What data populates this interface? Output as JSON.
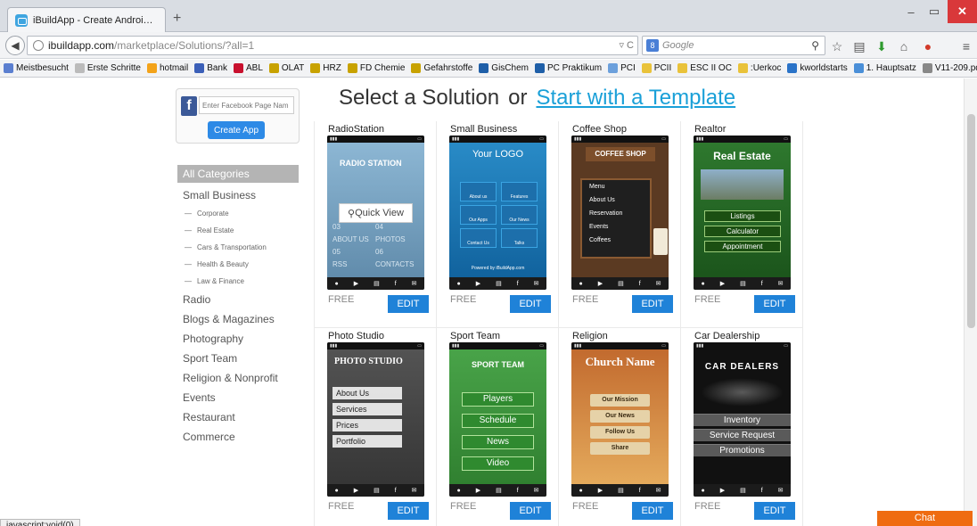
{
  "browser": {
    "tab_title": "iBuildApp - Create Android an...",
    "new_tab": "+",
    "window_controls": {
      "minimize": "–",
      "maximize": "▭",
      "close": "✕"
    },
    "url_host": "ibuildapp.com",
    "url_path": "/marketplace/Solutions/?all=1",
    "search_placeholder": "Google",
    "bookmarks": [
      "Meistbesucht",
      "Erste Schritte",
      "hotmail",
      "Bank",
      "ABL",
      "OLAT",
      "HRZ",
      "FD Chemie",
      "Gefahrstoffe",
      "GisChem",
      "PC Praktikum",
      "PCI",
      "PCII",
      "ESC II OC",
      ":Uerkoc",
      "kworldstarts",
      "1. Hauptsatz",
      "V11-209.pdf"
    ]
  },
  "sidebar": {
    "facebook_placeholder": "Enter Facebook Page Nam",
    "create_button": "Create App",
    "categories_all": "All Categories",
    "categories": [
      {
        "label": "Small Business",
        "subs": [
          "Corporate",
          "Real Estate",
          "Cars & Transportation",
          "Health & Beauty",
          "Law & Finance"
        ]
      },
      {
        "label": "Radio"
      },
      {
        "label": "Blogs & Magazines"
      },
      {
        "label": "Photography"
      },
      {
        "label": "Sport Team"
      },
      {
        "label": "Religion & Nonprofit"
      },
      {
        "label": "Events"
      },
      {
        "label": "Restaurant"
      },
      {
        "label": "Commerce"
      }
    ]
  },
  "main": {
    "heading": "Select a Solution",
    "or": "or",
    "template_link": "Start with a Template",
    "free_label": "FREE",
    "edit_label": "EDIT",
    "quick_view": "Quick View",
    "solutions": [
      {
        "name": "RadioStation",
        "screen": {
          "brand": "RADIO STATION",
          "tiles": [
            "03",
            "04",
            "ABOUT US",
            "PHOTOS",
            "05",
            "06",
            "RSS",
            "CONTACTS"
          ]
        }
      },
      {
        "name": "Small Business",
        "screen": {
          "logo": "Your LOGO",
          "buttons": [
            "About us",
            "Features",
            "Our Apps",
            "Our News",
            "Contact Us",
            "Talks"
          ],
          "powered": "Powered by iBuildApp.com"
        }
      },
      {
        "name": "Coffee Shop",
        "screen": {
          "banner": "COFFEE SHOP",
          "menu": [
            "Menu",
            "About Us",
            "Reservation",
            "Events",
            "Coffees"
          ]
        }
      },
      {
        "name": "Realtor",
        "screen": {
          "title": "Real Estate",
          "buttons": [
            "Listings",
            "Calculator",
            "Appointment"
          ]
        }
      },
      {
        "name": "Photo Studio",
        "screen": {
          "title": "PHOTO STUDIO",
          "buttons": [
            "About Us",
            "Services",
            "Prices",
            "Portfolio"
          ]
        }
      },
      {
        "name": "Sport Team",
        "screen": {
          "title": "SPORT TEAM",
          "buttons": [
            "Players",
            "Schedule",
            "News",
            "Video"
          ]
        }
      },
      {
        "name": "Religion",
        "screen": {
          "title": "Church Name",
          "buttons": [
            "Our Mission",
            "Our News",
            "Follow Us",
            "Share"
          ]
        }
      },
      {
        "name": "Car Dealership",
        "screen": {
          "title": "CAR DEALERS",
          "buttons": [
            "Inventory",
            "Service Request",
            "Promotions"
          ]
        }
      }
    ]
  },
  "statusbar": {
    "text": "javascript:void(0)"
  },
  "chat": {
    "label": "Chat"
  },
  "colors": {
    "accent": "#1aa0d8",
    "edit_button": "#1f82d8",
    "chat": "#ef6c11",
    "facebook": "#3b5998"
  }
}
